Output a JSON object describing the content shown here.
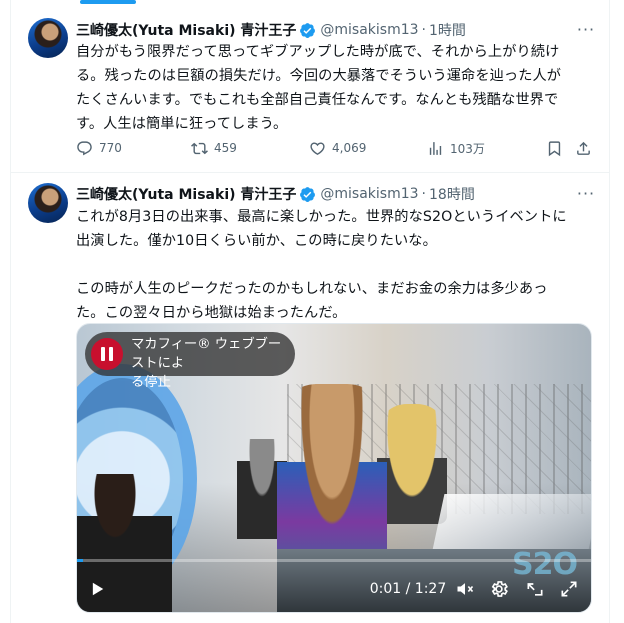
{
  "tweets": [
    {
      "author_name": "三崎優太(Yuta Misaki) 青汁王子",
      "handle": "@misakism13",
      "separator": "·",
      "time": "1時間",
      "text": "自分がもう限界だって思ってギブアップした時が底で、それから上がり続け\nる。残ったのは巨額の損失だけ。今回の大暴落でそういう運命を辿った人が\nたくさんいます。でもこれも全部自己責任なんです。なんとも残酷な世界で\nす。人生は簡単に狂ってしまう。",
      "stats": {
        "replies": "770",
        "reposts": "459",
        "likes": "4,069",
        "views": "103万"
      },
      "icons": {
        "reply": "reply-icon",
        "repost": "repost-icon",
        "like": "like-icon",
        "views": "views-icon",
        "bookmark": "bookmark-icon",
        "share": "share-icon",
        "more": "more-icon",
        "verified": "verified-icon"
      }
    },
    {
      "author_name": "三崎優太(Yuta Misaki) 青汁王子",
      "handle": "@misakism13",
      "separator": "·",
      "time": "18時間",
      "text": "これが8月3日の出来事、最高に楽しかった。世界的なS2Oというイベントに\n出演した。僅か10日くらい前か、この時に戻りたいな。\n\nこの時が人生のピークだったのかもしれない、まだお金の余力は多少あっ\nた。この翌々日から地獄は始まったんだ。",
      "video": {
        "overlay_text": "マカフィー® ウェブブーストによ\nる停止",
        "time_readout": "0:01 / 1:27",
        "progress": 0.0115,
        "watermark": "S2O",
        "icons": {
          "play": "play-icon",
          "mute": "muted-speaker-icon",
          "settings": "gear-icon",
          "pip": "picture-in-picture-icon",
          "fullscreen": "fullscreen-icon",
          "pause": "pause-icon"
        }
      }
    }
  ],
  "colors": {
    "accent": "#1d9bf0",
    "text": "#0f1419",
    "muted": "#536471",
    "pause_red": "#c8102e"
  }
}
